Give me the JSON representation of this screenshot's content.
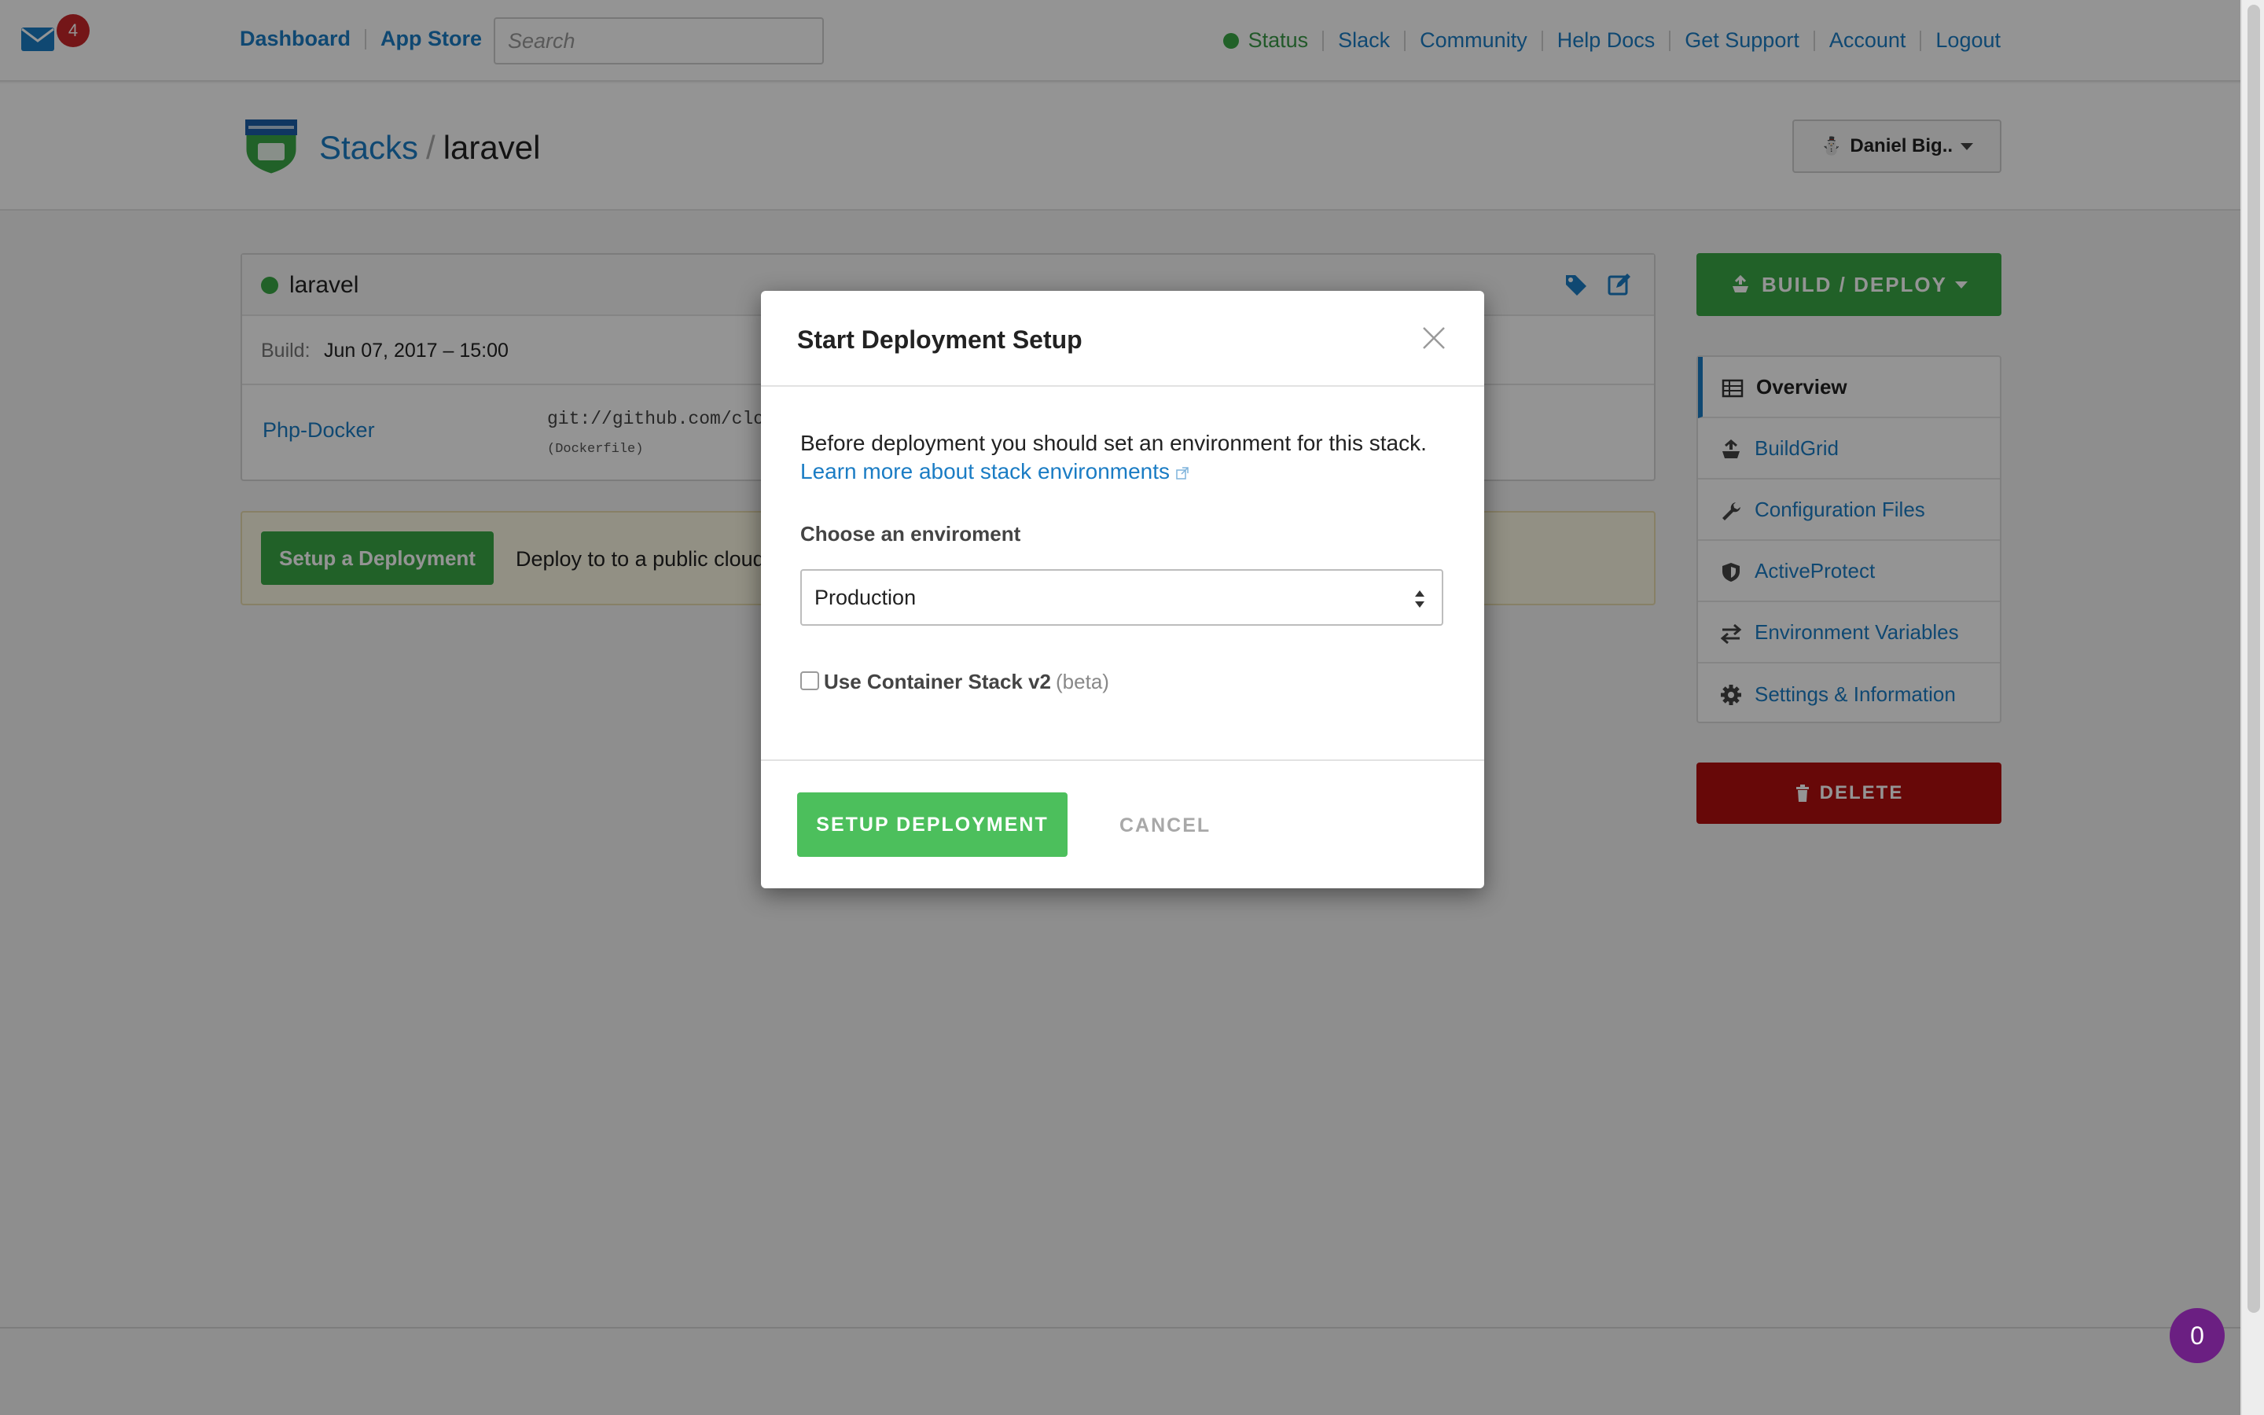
{
  "topbar": {
    "mail_badge": "4",
    "nav_left": [
      "Dashboard",
      "App Store"
    ],
    "search_placeholder": "Search",
    "status_label": "Status",
    "nav_right": [
      "Slack",
      "Community",
      "Help Docs",
      "Get Support",
      "Account",
      "Logout"
    ],
    "status_color": "#3aa745"
  },
  "header": {
    "breadcrumb_root": "Stacks",
    "breadcrumb_sep": "/",
    "breadcrumb_current": "laravel",
    "user_menu": "Daniel Big..",
    "logo_icon": "cloud66-logo"
  },
  "stack": {
    "name": "laravel",
    "build_label": "Build:",
    "build_value": "Jun 07, 2017 – 15:00",
    "service_name": "Php-Docker",
    "service_git": "git://github.com/clou",
    "service_dockerfile": "(Dockerfile)"
  },
  "deploy_bar": {
    "button": "Setup a Deployment",
    "text": "Deploy to to a public cloud"
  },
  "sidebar": {
    "build_deploy": "BUILD / DEPLOY",
    "items": [
      {
        "label": "Overview",
        "icon": "table-icon"
      },
      {
        "label": "BuildGrid",
        "icon": "buildgrid-icon"
      },
      {
        "label": "Configuration Files",
        "icon": "wrench-icon"
      },
      {
        "label": "ActiveProtect",
        "icon": "shield-icon"
      },
      {
        "label": "Environment Variables",
        "icon": "swap-icon"
      },
      {
        "label": "Settings & Information",
        "icon": "gear-icon"
      }
    ],
    "delete": "DELETE"
  },
  "modal": {
    "title": "Start Deployment Setup",
    "intro": "Before deployment you should set an environment for this stack.",
    "learn_more": "Learn more about stack environments",
    "choose_label": "Choose an enviroment",
    "selected_env": "Production",
    "checkbox_label": "Use Container Stack v2",
    "checkbox_beta": "(beta)",
    "checkbox_checked": false,
    "primary": "SETUP DEPLOYMENT",
    "cancel": "CANCEL"
  },
  "chat": {
    "count": "0"
  },
  "colors": {
    "accent": "#1a7cc4",
    "success": "#3aa745",
    "danger": "#b20e0e",
    "chat": "#6b1f82"
  }
}
